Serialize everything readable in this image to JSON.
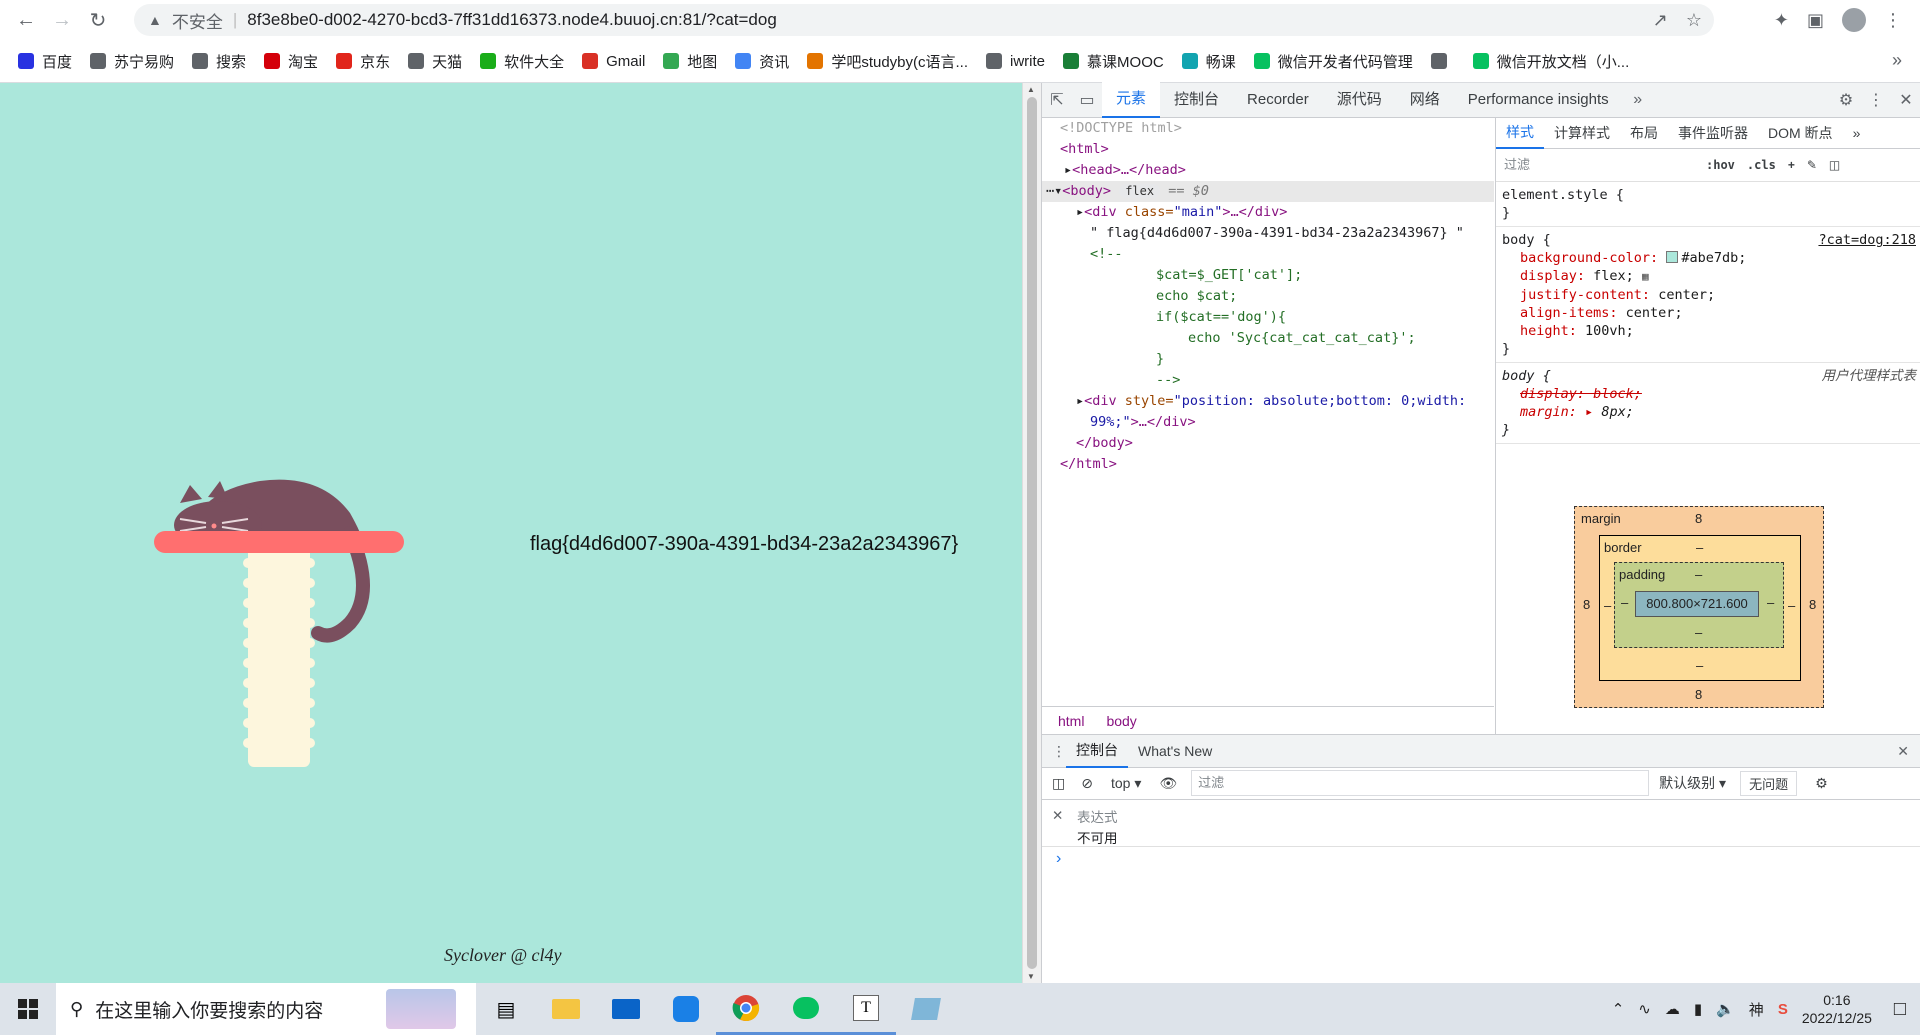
{
  "browser": {
    "insecure_label": "不安全",
    "url": "8f3e8be0-d002-4270-bcd3-7ff31dd16373.node4.buuoj.cn:81/?cat=dog"
  },
  "bookmarks": [
    {
      "label": "百度",
      "icon": "baidu-icon",
      "color": "#2932e1"
    },
    {
      "label": "苏宁易购",
      "icon": "globe-icon",
      "color": "#5f6368"
    },
    {
      "label": "搜索",
      "icon": "globe-icon",
      "color": "#5f6368"
    },
    {
      "label": "淘宝",
      "icon": "tmall-icon",
      "color": "#d4000a"
    },
    {
      "label": "京东",
      "icon": "jd-icon",
      "color": "#e1251b"
    },
    {
      "label": "天猫",
      "icon": "globe-icon",
      "color": "#5f6368"
    },
    {
      "label": "软件大全",
      "icon": "download-icon",
      "color": "#1aad19"
    },
    {
      "label": "Gmail",
      "icon": "gmail-icon",
      "color": "#d93025"
    },
    {
      "label": "地图",
      "icon": "maps-icon",
      "color": "#34a853"
    },
    {
      "label": "资讯",
      "icon": "news-icon",
      "color": "#4285f4"
    },
    {
      "label": "学吧studyby(c语言...",
      "icon": "studyby-icon",
      "color": "#e37400"
    },
    {
      "label": "iwrite",
      "icon": "globe-icon",
      "color": "#5f6368"
    },
    {
      "label": "慕课MOOC",
      "icon": "mooc-icon",
      "color": "#1a7f37"
    },
    {
      "label": "畅课",
      "icon": "changke-icon",
      "color": "#12a4b0"
    },
    {
      "label": "微信开发者代码管理",
      "icon": "wechat-icon",
      "color": "#07c160"
    },
    {
      "label": "",
      "icon": "globe-icon",
      "color": "#5f6368"
    },
    {
      "label": "微信开放文档（小...",
      "icon": "wechat-icon",
      "color": "#07c160"
    }
  ],
  "page": {
    "bg_color": "#abe7db",
    "flag_text": "flag{d4d6d007-390a-4391-bd34-23a2a2343967}",
    "credit": "Syclover @ cl4y"
  },
  "devtools": {
    "tabs": [
      "元素",
      "控制台",
      "Recorder",
      "源代码",
      "网络",
      "Performance insights"
    ],
    "active_tab": "元素",
    "dom": {
      "doctype": "<!DOCTYPE html>",
      "html_open": "<html>",
      "head": "<head>…</head>",
      "body_open": "<body>",
      "flex_chip": "flex",
      "eq0": "== $0",
      "div_main_tag": "<div ",
      "div_main_attr": "class=",
      "div_main_val": "\"main\"",
      "div_main_end": ">…</div>",
      "flag_node": "\" flag{d4d6d007-390a-4391-bd34-23a2a2343967} \"",
      "comment_open": "<!--",
      "code_1": "$cat=$_GET['cat'];",
      "code_2": "echo $cat;",
      "code_3": "if($cat=='dog'){",
      "code_4": "echo 'Syc{cat_cat_cat_cat}';",
      "code_5": "}",
      "comment_close": "-->",
      "div2_tag": "<div ",
      "div2_attr": "style=",
      "div2_val_1": "\"position: absolute;bottom: 0;width:",
      "div2_val_2": "99%;\"",
      "div2_end": ">…</div>",
      "body_close": "</body>",
      "html_close": "</html>"
    },
    "breadcrumbs": [
      "html",
      "body"
    ],
    "styles_tabs": [
      "样式",
      "计算样式",
      "布局",
      "事件监听器",
      "DOM 断点"
    ],
    "filter_placeholder": "过滤",
    "hov": ":hov",
    "cls": ".cls",
    "element_style": "element.style {",
    "body_rule": {
      "selector": "body {",
      "source": "?cat=dog:218",
      "props": [
        {
          "name": "background-color",
          "value": "#abe7db;"
        },
        {
          "name": "display",
          "value": "flex;"
        },
        {
          "name": "justify-content",
          "value": "center;"
        },
        {
          "name": "align-items",
          "value": "center;"
        },
        {
          "name": "height",
          "value": "100vh;"
        }
      ]
    },
    "ua_rule": {
      "selector": "body {",
      "source": "用户代理样式表",
      "display": "display: block;",
      "margin_name": "margin",
      "margin_value": "8px;"
    },
    "box_model": {
      "margin_label": "margin",
      "margin": "8",
      "border_label": "border",
      "border": "–",
      "padding_label": "padding",
      "padding": "–",
      "content": "800.800×721.600"
    },
    "console": {
      "tabs": [
        "控制台",
        "What's New"
      ],
      "context": "top",
      "filter_placeholder": "过滤",
      "level": "默认级别",
      "issues": "无问题",
      "expression_label": "表达式",
      "expression_value": "不可用",
      "prompt": "›"
    }
  },
  "taskbar": {
    "search_placeholder": "在这里输入你要搜索的内容",
    "time": "0:16",
    "date": "2022/12/25"
  }
}
